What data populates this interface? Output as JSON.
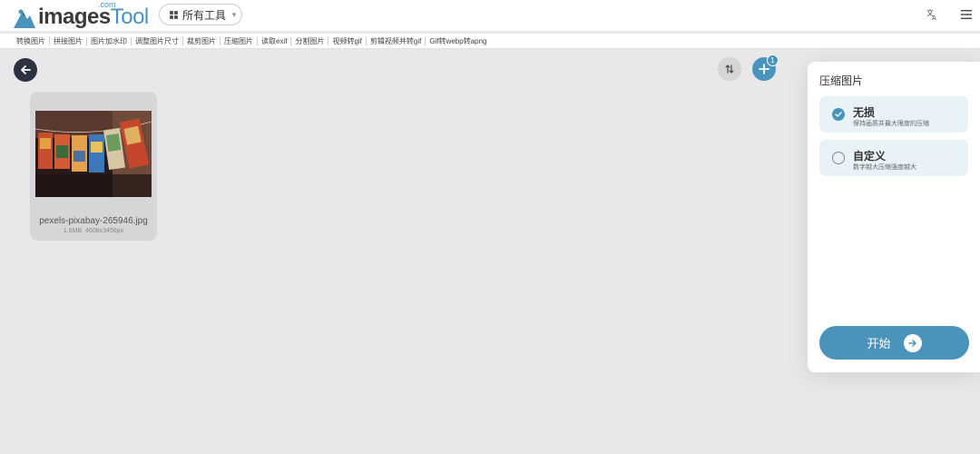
{
  "header": {
    "logo_main": "images",
    "logo_tool": "Tool",
    "logo_com": ".com",
    "tools_dropdown": "所有工具",
    "translate_icon": "translate-icon",
    "menu_icon": "hamburger-menu-icon"
  },
  "nav": {
    "items": [
      "转换图片",
      "拼接图片",
      "图片加水印",
      "调整图片尺寸",
      "裁剪图片",
      "压缩图片",
      "读取exif",
      "分割图片",
      "视频转gif",
      "剪辑视频并转gif",
      "Gif转webp转apng"
    ]
  },
  "toolbar": {
    "add_badge": "1"
  },
  "file": {
    "name": "pexels-pixabay-265946.jpg",
    "size": "1.6MB",
    "dimensions": "4608x3456px"
  },
  "panel": {
    "title": "压缩图片",
    "options": [
      {
        "title": "无损",
        "desc": "保持画质并最大限度的压缩",
        "selected": true
      },
      {
        "title": "自定义",
        "desc": "数字越大压缩强度越大",
        "selected": false
      }
    ],
    "start_label": "开始"
  },
  "colors": {
    "accent": "#4a93bb",
    "dark": "#2d3142",
    "background": "#e8e8ea",
    "option_bg": "#e9f2f6"
  }
}
